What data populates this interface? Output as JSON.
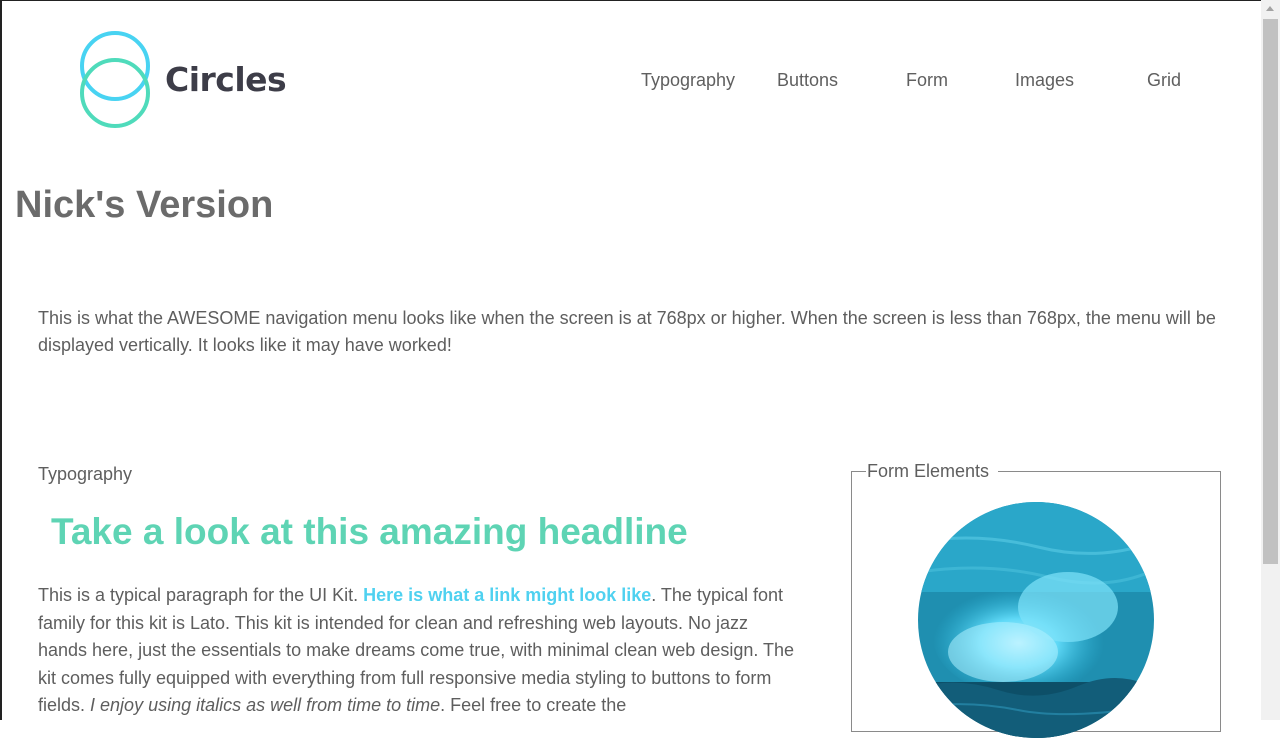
{
  "brand": {
    "name": "Circles",
    "logo_icon": "interlocking-circles-icon",
    "colors": {
      "circle_top": "#48d3f2",
      "circle_bottom": "#4fdbbb",
      "headline": "#5ed4b4",
      "link": "#4fd1f0"
    }
  },
  "nav": {
    "items": [
      {
        "label": "Typography"
      },
      {
        "label": "Buttons"
      },
      {
        "label": "Form"
      },
      {
        "label": "Images"
      },
      {
        "label": "Grid"
      }
    ]
  },
  "page": {
    "title": "Nick's Version",
    "intro": "This is what the AWESOME navigation menu looks like when the screen is at 768px or higher. When the screen is less than 768px, the menu will be displayed vertically. It looks like it may have worked!"
  },
  "typography": {
    "section_label": "Typography",
    "headline": "Take a look at this amazing headline",
    "para_part1": "This is a typical paragraph for the UI Kit. ",
    "para_link": "Here is what a link might look like",
    "para_part2": ". The typical font family for this kit is Lato. This kit is intended for clean and refreshing web layouts. No jazz hands here, just the essentials to make dreams come true, with minimal clean web design. The kit comes fully equipped with everything from full responsive media styling to buttons to form fields. ",
    "para_italic": "I enjoy using italics as well from time to time",
    "para_part3": ". Feel free to create the"
  },
  "form": {
    "legend": "Form Elements",
    "image": "ocean-wave-circle-image"
  }
}
